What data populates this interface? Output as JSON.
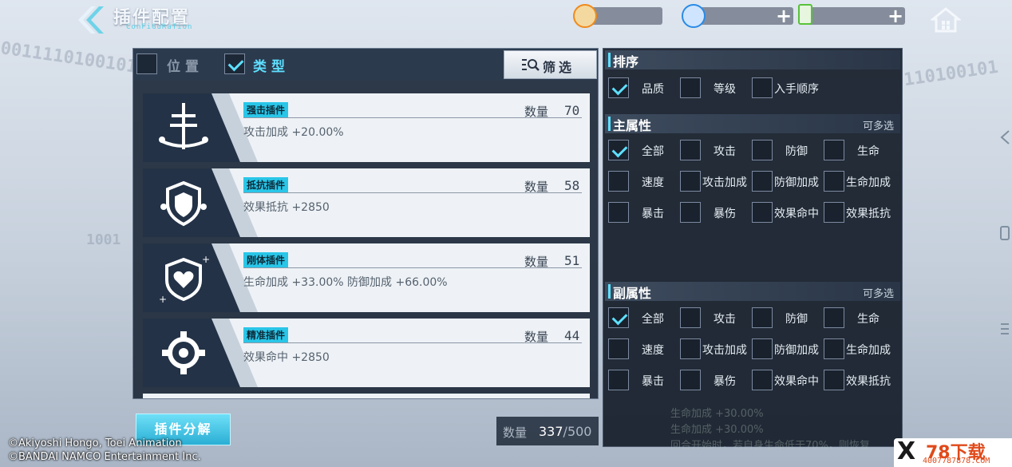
{
  "header": {
    "title": "插件配置",
    "subtitle": "ConFiGuRaTion"
  },
  "resources": [
    {
      "icon": "stamina-icon",
      "value": "",
      "color": "#f08a1c"
    },
    {
      "icon": "crystal-icon",
      "value": "",
      "color": "#2a8be8"
    },
    {
      "icon": "battery-icon",
      "value": "",
      "color": "#58c238"
    }
  ],
  "left_panel": {
    "tabs": [
      {
        "label": "位置",
        "checked": false
      },
      {
        "label": "类型",
        "checked": true
      }
    ],
    "filter_label": "筛选",
    "cards": [
      {
        "name": "强击插件",
        "effect": "攻击加成 +20.00%",
        "qty_label": "数量",
        "qty": "70",
        "icon": "sword-icon"
      },
      {
        "name": "抵抗插件",
        "effect": "效果抵抗 +2850",
        "qty_label": "数量",
        "qty": "58",
        "icon": "shield-icon"
      },
      {
        "name": "刚体插件",
        "effect": "生命加成 +33.00% 防御加成 +66.00%",
        "qty_label": "数量",
        "qty": "51",
        "icon": "heart-shield-icon"
      },
      {
        "name": "精准插件",
        "effect": "效果命中 +2850",
        "qty_label": "数量",
        "qty": "44",
        "icon": "gear-icon"
      }
    ],
    "decompose_label": "插件分解",
    "total_label": "数量",
    "total_value": "337",
    "total_max": "/500"
  },
  "copyright": {
    "line1": "©Akiyoshi Hongo, Toei Animation",
    "line2": "©BANDAI NAMCO Entertainment Inc."
  },
  "right_panel": {
    "sort": {
      "title": "排序",
      "options": [
        {
          "label": "品质",
          "checked": true
        },
        {
          "label": "等级",
          "checked": false
        },
        {
          "label": "入手顺序",
          "checked": false
        }
      ]
    },
    "main_attr": {
      "title": "主属性",
      "multi": "可多选",
      "options": [
        {
          "label": "全部",
          "checked": true
        },
        {
          "label": "攻击",
          "checked": false
        },
        {
          "label": "防御",
          "checked": false
        },
        {
          "label": "生命",
          "checked": false
        },
        {
          "label": "速度",
          "checked": false
        },
        {
          "label": "攻击加成",
          "checked": false
        },
        {
          "label": "防御加成",
          "checked": false
        },
        {
          "label": "生命加成",
          "checked": false
        },
        {
          "label": "暴击",
          "checked": false
        },
        {
          "label": "暴伤",
          "checked": false
        },
        {
          "label": "效果命中",
          "checked": false
        },
        {
          "label": "效果抵抗",
          "checked": false
        }
      ]
    },
    "sub_attr": {
      "title": "副属性",
      "multi": "可多选",
      "options": [
        {
          "label": "全部",
          "checked": true
        },
        {
          "label": "攻击",
          "checked": false
        },
        {
          "label": "防御",
          "checked": false
        },
        {
          "label": "生命",
          "checked": false
        },
        {
          "label": "速度",
          "checked": false
        },
        {
          "label": "攻击加成",
          "checked": false
        },
        {
          "label": "防御加成",
          "checked": false
        },
        {
          "label": "生命加成",
          "checked": false
        },
        {
          "label": "暴击",
          "checked": false
        },
        {
          "label": "暴伤",
          "checked": false
        },
        {
          "label": "效果命中",
          "checked": false
        },
        {
          "label": "效果抵抗",
          "checked": false
        }
      ]
    },
    "behind_text": [
      "生命加成 +30.00%",
      "生命加成 +30.00%",
      "回合开始时，若自身生命低于70%，则恢复"
    ]
  },
  "watermark": {
    "big": "78下载",
    "small": "4007787878.COM",
    "mark": "X"
  },
  "colors": {
    "accent": "#5ee0ff",
    "tag": "#29c6e8",
    "panel": "#1e2a3a"
  }
}
